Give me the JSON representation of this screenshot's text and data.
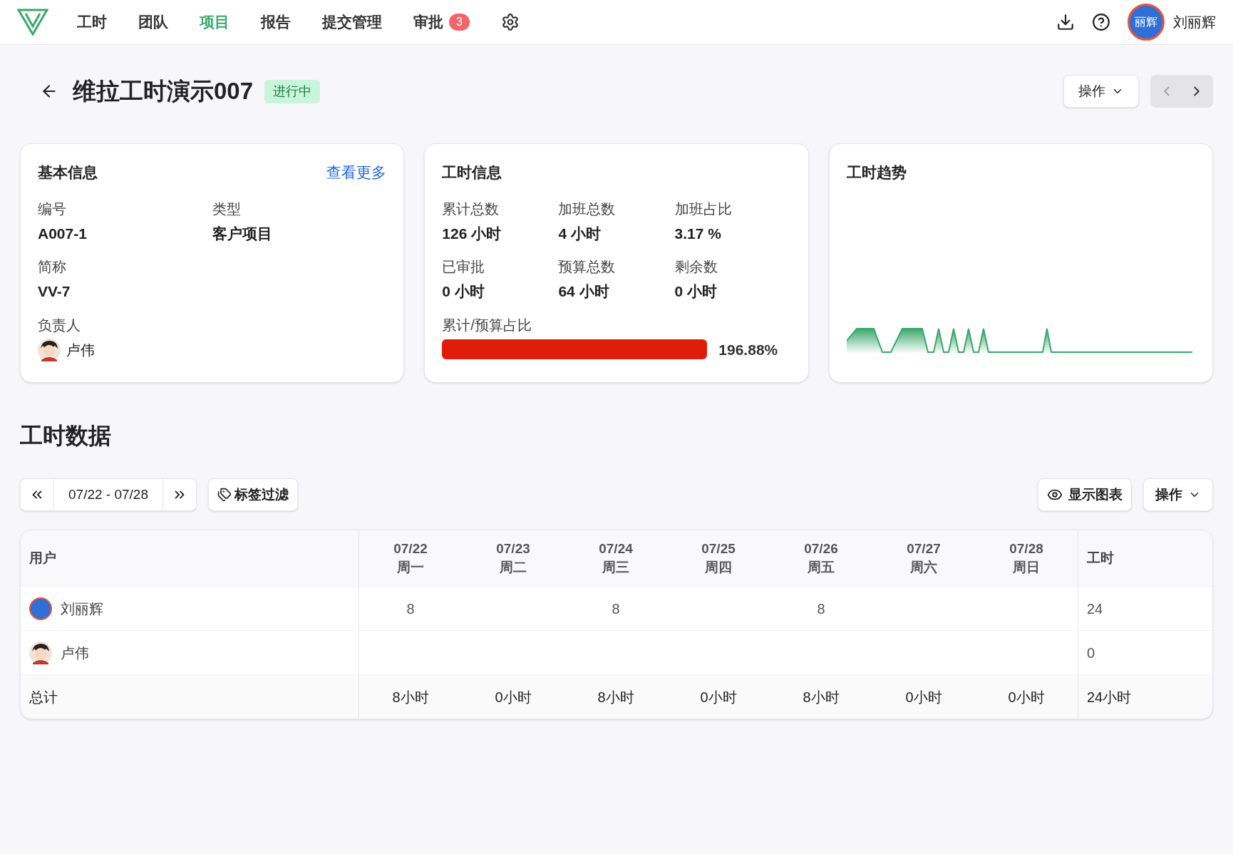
{
  "nav": {
    "items": [
      {
        "label": "工时",
        "selected": false
      },
      {
        "label": "团队",
        "selected": false
      },
      {
        "label": "项目",
        "selected": true
      },
      {
        "label": "报告",
        "selected": false
      },
      {
        "label": "提交管理",
        "selected": false
      },
      {
        "label": "审批",
        "selected": false,
        "badge": "3"
      }
    ],
    "user": {
      "avatar_text": "丽辉",
      "name": "刘丽辉"
    }
  },
  "header": {
    "title": "维拉工时演示007",
    "status": "进行中",
    "actions_button": "操作"
  },
  "basic_info": {
    "title": "基本信息",
    "more_link": "查看更多",
    "fields": [
      {
        "label": "编号",
        "value": "A007-1"
      },
      {
        "label": "类型",
        "value": "客户项目"
      },
      {
        "label": "简称",
        "value": "VV-7"
      }
    ],
    "owner": {
      "label": "负责人",
      "name": "卢伟"
    }
  },
  "hours_info": {
    "title": "工时信息",
    "fields": [
      {
        "label": "累计总数",
        "value": "126 小时"
      },
      {
        "label": "加班总数",
        "value": "4 小时"
      },
      {
        "label": "加班占比",
        "value": "3.17 %"
      },
      {
        "label": "已审批",
        "value": "0 小时"
      },
      {
        "label": "预算总数",
        "value": "64 小时"
      },
      {
        "label": "剩余数",
        "value": "0 小时"
      }
    ],
    "ratio": {
      "label": "累计/预算占比",
      "level": 1,
      "reading": "196.88%"
    }
  },
  "trend": {
    "title": "工时趋势"
  },
  "section_title": "工时数据",
  "toolbar": {
    "date_range": "07/22 - 07/28",
    "tag_filter": "标签过滤",
    "show_chart": "显示图表",
    "actions": "操作"
  },
  "table": {
    "user_header": "用户",
    "total_header": "工时",
    "days": [
      {
        "date": "07/22",
        "weekday": "周一"
      },
      {
        "date": "07/23",
        "weekday": "周二"
      },
      {
        "date": "07/24",
        "weekday": "周三"
      },
      {
        "date": "07/25",
        "weekday": "周四"
      },
      {
        "date": "07/26",
        "weekday": "周五"
      },
      {
        "date": "07/27",
        "weekday": "周六"
      },
      {
        "date": "07/28",
        "weekday": "周日"
      }
    ],
    "rows": [
      {
        "user": "刘丽辉",
        "avatar": {
          "kind": "badge"
        },
        "cells": [
          "8",
          null,
          "8",
          null,
          "8",
          null,
          null
        ],
        "total": "24"
      },
      {
        "user": "卢伟",
        "avatar": {
          "kind": "person"
        },
        "cells": [
          null,
          null,
          null,
          null,
          null,
          null,
          null
        ],
        "total": "0"
      }
    ],
    "footer": {
      "label": "总计",
      "cells": [
        "8小时",
        "0小时",
        "8小时",
        "0小时",
        "8小时",
        "0小时",
        "0小时"
      ],
      "total": "24小时"
    }
  }
}
